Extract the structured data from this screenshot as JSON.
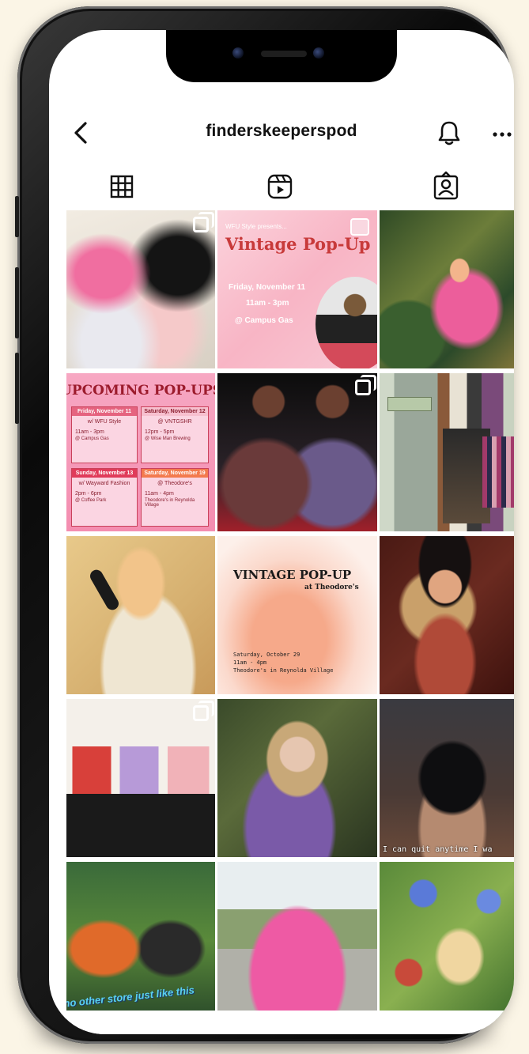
{
  "profile": {
    "username": "finderskeeperspod"
  },
  "icons": {
    "back": "chevron-left-icon",
    "notifications": "bell-icon",
    "more": "more-horizontal-icon",
    "grid_tab": "grid-icon",
    "reels_tab": "reels-icon",
    "tagged_tab": "tagged-person-icon"
  },
  "posts": {
    "vintage_popup": {
      "kicker": "WFU Style presents...",
      "title": "Vintage Pop-Up",
      "date": "Friday, November 11",
      "time": "11am - 3pm",
      "place": "@ Campus Gas"
    },
    "upcoming": {
      "title": "UPCOMING POP-UPS",
      "events": [
        {
          "day": "Friday, November 11",
          "host": "w/ WFU Style",
          "time": "11am - 3pm",
          "place": "@ Campus Gas"
        },
        {
          "day": "Saturday, November 12",
          "host": "@ VNTGSHR",
          "time": "12pm - 5pm",
          "place": "@ Wise Man Brewing"
        },
        {
          "day": "Sunday, November 13",
          "host": "w/ Wayward Fashion",
          "time": "2pm - 6pm",
          "place": "@ Coffee Park"
        },
        {
          "day": "Saturday, November 19",
          "host": "@ Theodore's",
          "time": "11am - 4pm",
          "place": "Theodore's in Reynolda Village"
        }
      ]
    },
    "theodores": {
      "title": "VINTAGE POP-UP",
      "subtitle": "at Theodore's",
      "date": "Saturday, October 29",
      "time": "11am - 4pm",
      "place": "Theodore's in Reynolda Village"
    },
    "caption_cat": "I can quit anytime I wa",
    "caption_store": "no other store just like this"
  },
  "colors": {
    "background": "#fbf5e6",
    "text": "#111111",
    "pink": "#f4a7c0"
  }
}
